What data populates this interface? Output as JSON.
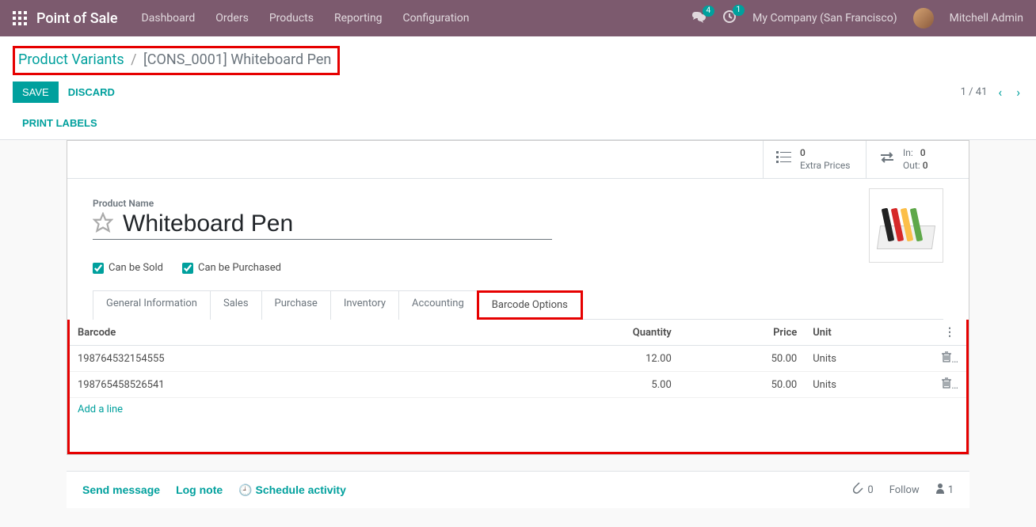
{
  "navbar": {
    "app_name": "Point of Sale",
    "links": [
      "Dashboard",
      "Orders",
      "Products",
      "Reporting",
      "Configuration"
    ],
    "chat_badge": "4",
    "activity_badge": "1",
    "company": "My Company (San Francisco)",
    "user": "Mitchell Admin"
  },
  "breadcrumb": {
    "parent": "Product Variants",
    "current": "[CONS_0001] Whiteboard Pen"
  },
  "buttons": {
    "save": "SAVE",
    "discard": "DISCARD",
    "print": "PRINT LABELS"
  },
  "pager": {
    "text": "1 / 41"
  },
  "stats": {
    "extra_count": "0",
    "extra_label": "Extra Prices",
    "in_label": "In:",
    "in_val": "0",
    "out_label": "Out:",
    "out_val": "0"
  },
  "form": {
    "name_label": "Product Name",
    "name": "Whiteboard Pen",
    "can_sold": "Can be Sold",
    "can_purchased": "Can be Purchased"
  },
  "tabs": [
    "General Information",
    "Sales",
    "Purchase",
    "Inventory",
    "Accounting",
    "Barcode Options"
  ],
  "table": {
    "headers": {
      "barcode": "Barcode",
      "qty": "Quantity",
      "price": "Price",
      "unit": "Unit"
    },
    "rows": [
      {
        "barcode": "198764532154555",
        "qty": "12.00",
        "price": "50.00",
        "unit": "Units"
      },
      {
        "barcode": "198765458526541",
        "qty": "5.00",
        "price": "50.00",
        "unit": "Units"
      }
    ],
    "add": "Add a line"
  },
  "chatter": {
    "send": "Send message",
    "log": "Log note",
    "schedule": "Schedule activity",
    "attach": "0",
    "follow": "Follow",
    "followers": "1"
  }
}
